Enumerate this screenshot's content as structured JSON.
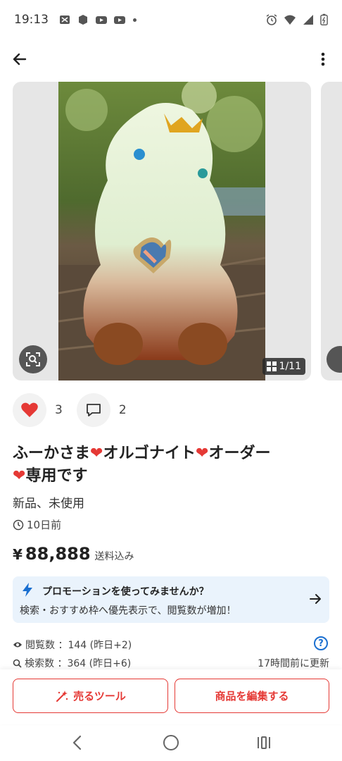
{
  "status_bar": {
    "time": "19:13"
  },
  "carousel": {
    "counter": "1/11"
  },
  "reactions": {
    "likes": "3",
    "comments": "2"
  },
  "item": {
    "title_parts": [
      "ふーかさま",
      "オルゴナイト",
      "オーダー",
      "専用です"
    ],
    "condition": "新品、未使用",
    "posted": "10日前",
    "price_currency": "¥",
    "price": "88,888",
    "shipping": "送料込み"
  },
  "promotion": {
    "title": "プロモーションを使ってみませんか？",
    "description": "検索・おすすめ枠へ優先表示で、閲覧数が増加！"
  },
  "stats": {
    "views": "閲覧数 ：144 (昨日+2)",
    "searches": "検索数 ：364 (昨日+6)",
    "updated": "17時間前に更新"
  },
  "actions": {
    "sell_tool": "売るツール",
    "edit_item": "商品を編集する"
  },
  "colors": {
    "accent": "#e53935",
    "promo_bg": "#eaf3fc",
    "link_blue": "#1a6fd0"
  }
}
